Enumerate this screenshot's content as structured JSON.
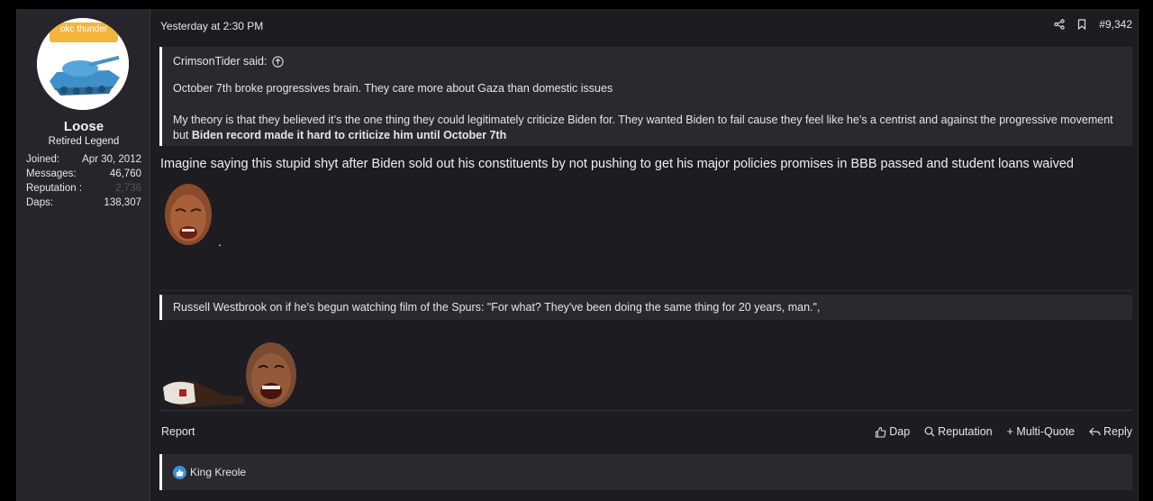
{
  "user": {
    "avatar_banner": "okc thunder",
    "username": "Loose",
    "title": "Retired Legend",
    "stats": [
      {
        "label": "Joined:",
        "value": "Apr 30, 2012",
        "dim": false
      },
      {
        "label": "Messages:",
        "value": "46,760",
        "dim": false
      },
      {
        "label": "Reputation :",
        "value": "2,736",
        "dim": true
      },
      {
        "label": "Daps:",
        "value": "138,307",
        "dim": false
      }
    ]
  },
  "post": {
    "date": "Yesterday at 2:30 PM",
    "number": "#9,342",
    "quote": {
      "author": "CrimsonTider said:",
      "line1": "October 7th broke progressives brain. They care more about Gaza than domestic issues",
      "line2": "My theory is that they believed it’s the one thing they could legitimately criticize Biden for. They wanted Biden to fail cause they feel like he’s a centrist and against the progressive movement but ",
      "line2_bold": "Biden record made it hard to criticize him until October 7th"
    },
    "body": "Imagine saying this stupid shyt after Biden sold out his constituents by not pushing to get his major policies promises in BBB passed and student loans waived",
    "dot": "."
  },
  "signature": {
    "quote": "Russell Westbrook on if he's begun watching film of the Spurs: \"For what? They've been doing the same thing for 20 years, man.\","
  },
  "footer": {
    "report": "Report",
    "dap": "Dap",
    "reputation": "Reputation",
    "multiquote": "+ Multi-Quote",
    "reply": "Reply"
  },
  "reactions": {
    "names": "King Kreole"
  },
  "colors": {
    "background": "#1d1c20",
    "sidebar": "#26252b",
    "quote_bg": "#2a292f",
    "banner": "#f2b63e",
    "like": "#3d8fd9"
  }
}
